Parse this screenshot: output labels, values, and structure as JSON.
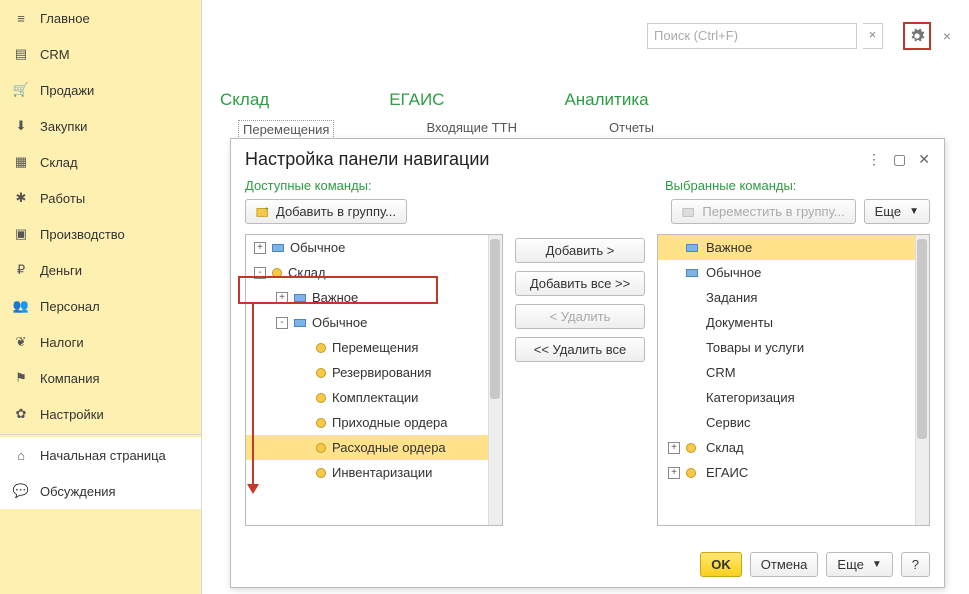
{
  "sidebar": {
    "items": [
      {
        "label": "Главное",
        "icon": "menu"
      },
      {
        "label": "CRM",
        "icon": "card"
      },
      {
        "label": "Продажи",
        "icon": "cart"
      },
      {
        "label": "Закупки",
        "icon": "inbox"
      },
      {
        "label": "Склад",
        "icon": "grid"
      },
      {
        "label": "Работы",
        "icon": "wrench"
      },
      {
        "label": "Производство",
        "icon": "factory"
      },
      {
        "label": "Деньги",
        "icon": "ruble"
      },
      {
        "label": "Персонал",
        "icon": "people"
      },
      {
        "label": "Налоги",
        "icon": "eagle"
      },
      {
        "label": "Компания",
        "icon": "flag"
      },
      {
        "label": "Настройки",
        "icon": "gear"
      }
    ],
    "home": "Начальная страница",
    "discuss": "Обсуждения"
  },
  "top": {
    "search_placeholder": "Поиск (Ctrl+F)"
  },
  "headers": {
    "h1": "Склад",
    "h2": "ЕГАИС",
    "h3": "Аналитика"
  },
  "subheaders": {
    "s1": "Перемещения",
    "s2": "Входящие ТТН",
    "s3": "Отчеты"
  },
  "dialog": {
    "title": "Настройка панели навигации",
    "available_label": "Доступные команды:",
    "selected_label": "Выбранные команды:",
    "add_to_group": "Добавить в группу...",
    "move_to_group": "Переместить в группу...",
    "more": "Еще",
    "mid": {
      "add": "Добавить >",
      "add_all": "Добавить все >>",
      "remove": "< Удалить",
      "remove_all": "<< Удалить все"
    },
    "left_tree": [
      {
        "label": "Обычное",
        "lvl": 0,
        "exp": "+",
        "kind": "blue"
      },
      {
        "label": "Склад",
        "lvl": 0,
        "exp": "-",
        "kind": "yellow",
        "framed": true
      },
      {
        "label": "Важное",
        "lvl": 1,
        "exp": "+",
        "kind": "blue"
      },
      {
        "label": "Обычное",
        "lvl": 1,
        "exp": "-",
        "kind": "blue"
      },
      {
        "label": "Перемещения",
        "lvl": 2,
        "kind": "yellow"
      },
      {
        "label": "Резервирования",
        "lvl": 2,
        "kind": "yellow"
      },
      {
        "label": "Комплектации",
        "lvl": 2,
        "kind": "yellow"
      },
      {
        "label": "Приходные ордера",
        "lvl": 2,
        "kind": "yellow"
      },
      {
        "label": "Расходные ордера",
        "lvl": 2,
        "kind": "yellow",
        "sel": true
      },
      {
        "label": "Инвентаризации",
        "lvl": 2,
        "kind": "yellow"
      }
    ],
    "right_list": [
      {
        "label": "Важное",
        "kind": "blue",
        "sel": true,
        "exp": ""
      },
      {
        "label": "Обычное",
        "kind": "blue",
        "exp": ""
      },
      {
        "label": "Задания",
        "exp": ""
      },
      {
        "label": "Документы",
        "exp": ""
      },
      {
        "label": "Товары и услуги",
        "exp": ""
      },
      {
        "label": "CRM",
        "exp": ""
      },
      {
        "label": "Категоризация",
        "exp": ""
      },
      {
        "label": "Сервис",
        "exp": ""
      },
      {
        "label": "Склад",
        "kind": "yellow",
        "exp": "+"
      },
      {
        "label": "ЕГАИС",
        "kind": "yellow",
        "exp": "+"
      }
    ],
    "footer": {
      "ok": "OK",
      "cancel": "Отмена",
      "more": "Еще",
      "help": "?"
    }
  }
}
